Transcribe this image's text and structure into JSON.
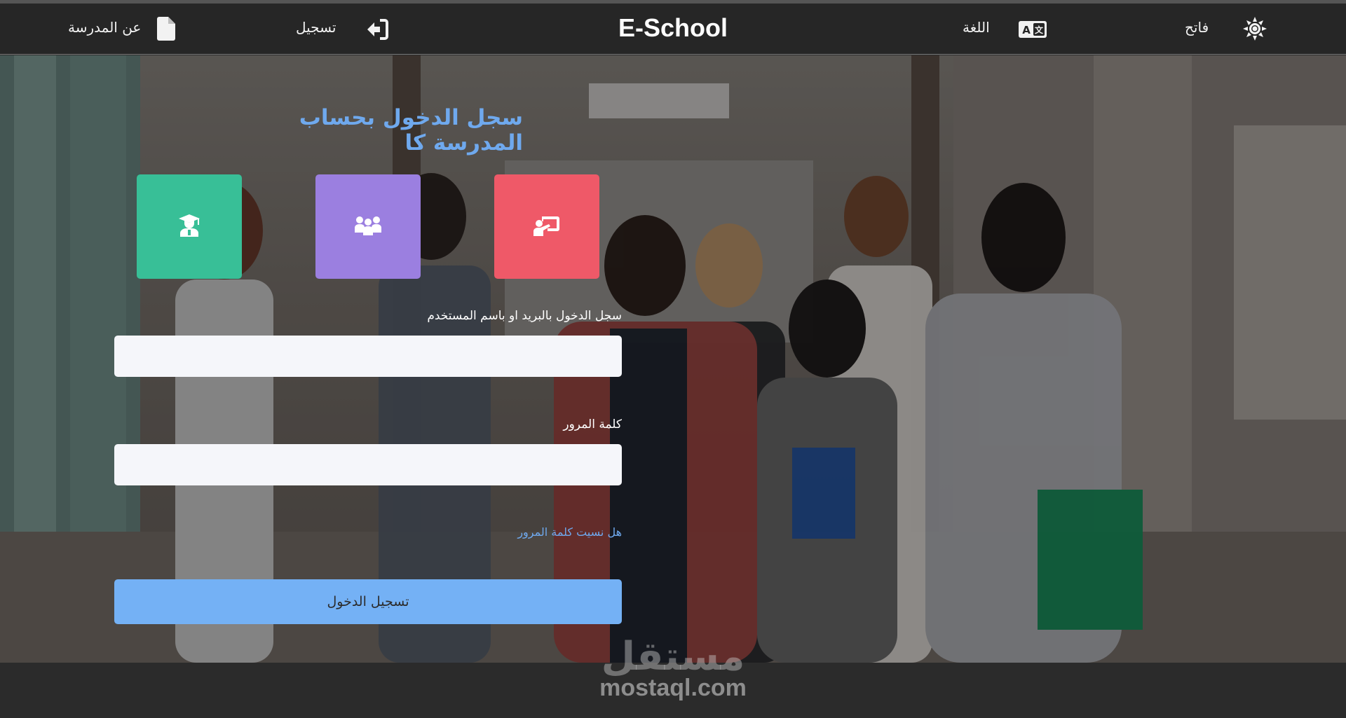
{
  "nav": {
    "brand": "E-School",
    "about_label": "عن المدرسة",
    "register_label": "تسجيل",
    "language_label": "اللغة",
    "theme_label": "فاتح"
  },
  "login": {
    "title": "سجل الدخول بحساب المدرسة كا",
    "roles": [
      "student-icon",
      "parents-icon",
      "teacher-icon"
    ],
    "username_label": "سجل الدخول بالبريد او باسم المستخدم",
    "username_value": "",
    "password_label": "كلمة المرور",
    "password_value": "",
    "forgot_label": "هل نسيت كلمة المرور",
    "submit_label": "تسجيل الدخول"
  },
  "watermark": {
    "arabic": "مستقل",
    "latin": "mostaql.com"
  },
  "colors": {
    "navbar": "#262626",
    "accent_blue": "#74b1f5",
    "title_blue": "#6fa9ee",
    "student_card": "#38bf97",
    "parent_card": "#9b7fe0",
    "teacher_card": "#ef5968",
    "input_bg": "#f5f6fa"
  }
}
